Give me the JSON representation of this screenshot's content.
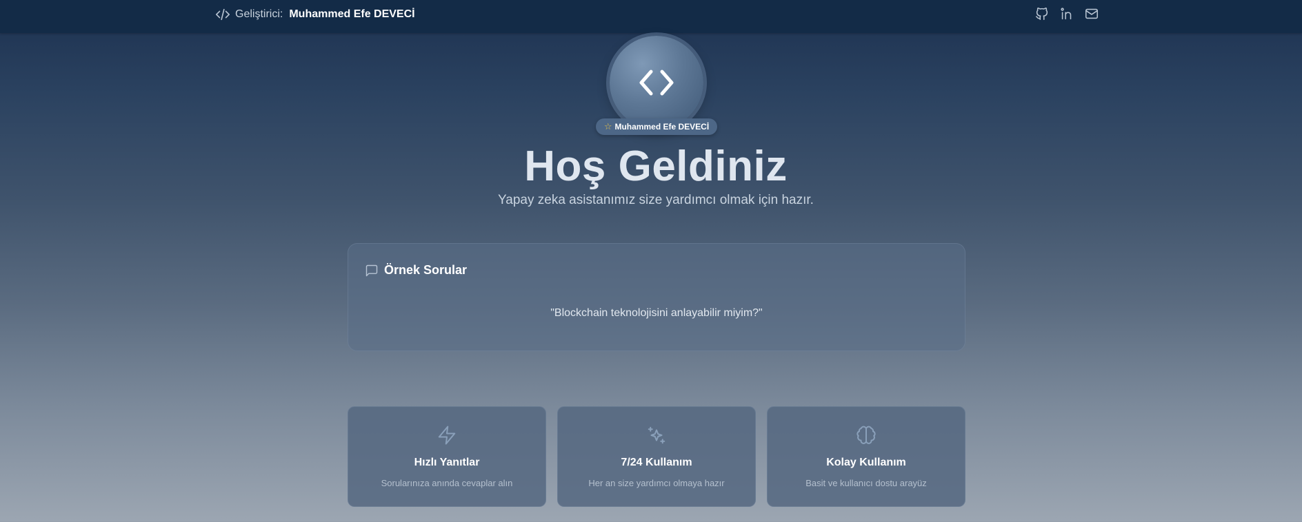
{
  "header": {
    "developer_label": "Geliştirici:",
    "developer_name": "Muhammed Efe DEVECİ",
    "social": [
      "github-icon",
      "linkedin-icon",
      "mail-icon"
    ]
  },
  "hero": {
    "badge": "Muhammed Efe DEVECİ",
    "title": "Hoş Geldiniz",
    "subtitle": "Yapay zeka asistanımız size yardımcı olmak için hazır."
  },
  "examples": {
    "title": "Örnek Sorular",
    "question": "\"Blockchain teknolojisini anlayabilir miyim?\""
  },
  "features": [
    {
      "icon": "zap-icon",
      "title": "Hızlı Yanıtlar",
      "desc": "Sorularınıza anında cevaplar alın"
    },
    {
      "icon": "sparkles-icon",
      "title": "7/24 Kullanım",
      "desc": "Her an size yardımcı olmaya hazır"
    },
    {
      "icon": "brain-icon",
      "title": "Kolay Kullanım",
      "desc": "Basit ve kullanıcı dostu arayüz"
    }
  ],
  "colors": {
    "topbar": "#132b47",
    "badge_star": "#e5c04a"
  }
}
